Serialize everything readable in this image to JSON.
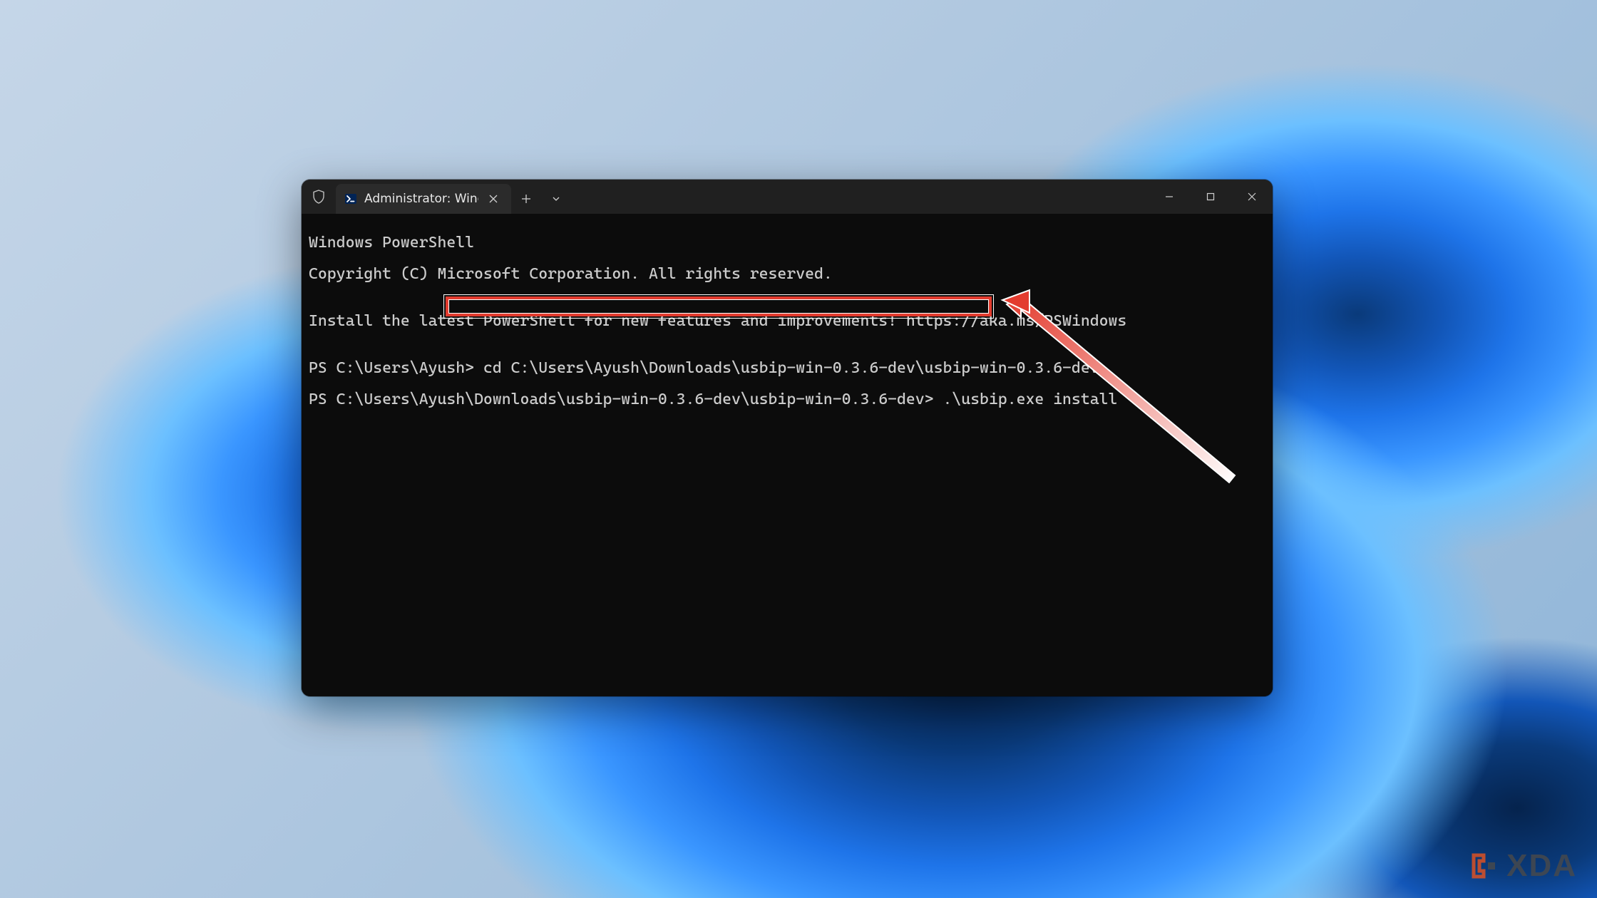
{
  "tab": {
    "title": "Administrator: Windows Powe"
  },
  "terminal": {
    "line1": "Windows PowerShell",
    "line2": "Copyright (C) Microsoft Corporation. All rights reserved.",
    "line3": "",
    "line4": "Install the latest PowerShell for new features and improvements! https://aka.ms/PSWindows",
    "line5": "",
    "prompt1_path": "PS C:\\Users\\Ayush>",
    "prompt1_cmd": " cd C:\\Users\\Ayush\\Downloads\\usbip-win-0.3.6-dev\\usbip-win-0.3.6-dev",
    "prompt2_path": "PS C:\\Users\\Ayush\\Downloads\\usbip-win-0.3.6-dev\\usbip-win-0.3.6-dev>",
    "prompt2_cmd": " .\\usbip.exe install"
  },
  "watermark": {
    "text": "XDA"
  }
}
